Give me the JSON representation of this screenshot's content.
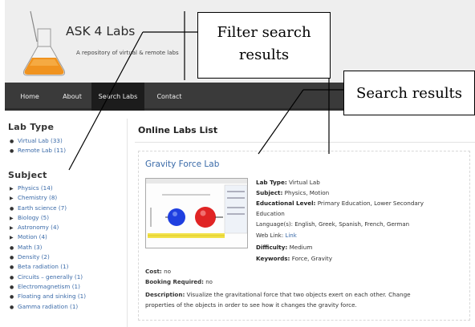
{
  "header": {
    "title": "ASK 4 Labs",
    "subtitle": "A repository of virtual & remote labs"
  },
  "nav": {
    "items": [
      "Home",
      "About",
      "Search Labs",
      "Contact"
    ],
    "active": "Search Labs"
  },
  "sidebar": {
    "lab_type_heading": "Lab Type",
    "lab_types": [
      "Virtual Lab (33)",
      "Remote Lab (11)"
    ],
    "subject_heading": "Subject",
    "subjects": [
      {
        "label": "Physics (14)",
        "expandable": true
      },
      {
        "label": "Chemistry (8)",
        "expandable": true
      },
      {
        "label": "Earth science (7)",
        "expandable": false
      },
      {
        "label": "Biology (5)",
        "expandable": true
      },
      {
        "label": "Astronomy (4)",
        "expandable": true
      },
      {
        "label": "Motion (4)",
        "expandable": true
      },
      {
        "label": "Math (3)",
        "expandable": false
      },
      {
        "label": "Density (2)",
        "expandable": false
      },
      {
        "label": "Beta radiation (1)",
        "expandable": false
      },
      {
        "label": "Circuits – generally (1)",
        "expandable": false
      },
      {
        "label": "Electromagnetism (1)",
        "expandable": false
      },
      {
        "label": "Floating and sinking (1)",
        "expandable": false
      },
      {
        "label": "Gamma radiation (1)",
        "expandable": false
      }
    ]
  },
  "main": {
    "list_title": "Online Labs List",
    "lab": {
      "title": "Gravity Force Lab",
      "lab_type_label": "Lab Type:",
      "lab_type": "Virtual Lab",
      "subject_label": "Subject:",
      "subject": "Physics, Motion",
      "edu_level_label": "Educational Level:",
      "edu_level_line1": "Primary Education, Lower Secondary",
      "edu_level_line2": "Education",
      "languages_label": "Language(s):",
      "languages": "English, Greek, Spanish, French, German",
      "web_link_label": "Web Link:",
      "web_link": "Link",
      "difficulty_label": "Difficulty:",
      "difficulty": "Medium",
      "keywords_label": "Keywords:",
      "keywords": "Force, Gravity",
      "cost_label": "Cost:",
      "cost": "no",
      "booking_label": "Booking Required:",
      "booking": "no",
      "description_label": "Description:",
      "description_line1": "Visualize the gravitational force that two objects exert on each other. Change",
      "description_line2": "properties of the objects in order to see how it changes the gravity force."
    }
  },
  "annotations": {
    "filter_line1": "Filter search",
    "filter_line2": "results",
    "search_results": "Search results"
  },
  "colors": {
    "nav_bg": "#3a3a3a",
    "nav_active": "#1c1c1c",
    "link": "#3a6aa8",
    "header_bg": "#eeeeee"
  }
}
